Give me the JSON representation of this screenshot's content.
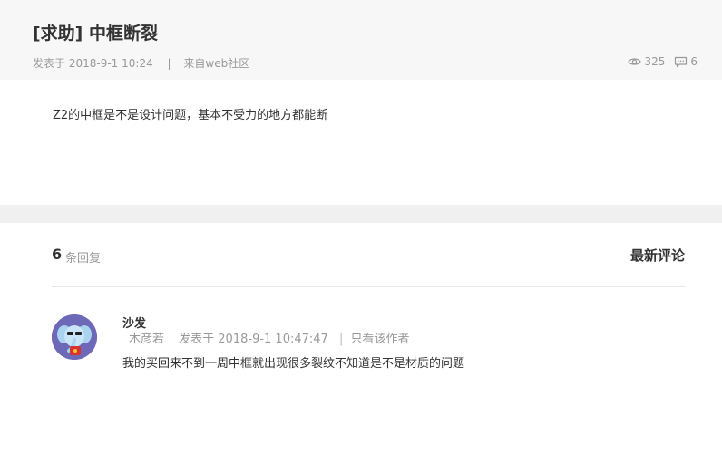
{
  "post": {
    "title": "[求助] 中框断裂",
    "posted_prefix": "发表于",
    "posted_time": "2018-9-1 10:24",
    "separator": "|",
    "source": "来自web社区",
    "views": "325",
    "comments": "6",
    "body": "Z2的中框是不是设计问题，基本不受力的地方都能断"
  },
  "replies": {
    "count": "6",
    "unit": "条回复",
    "sort_label": "最新评论",
    "items": [
      {
        "user": "沙发",
        "author": "木彦若",
        "posted": "发表于 2018-9-1 10:47:47",
        "pipe": "|",
        "only_author": "只看该作者",
        "text": "我的买回来不到一周中框就出现很多裂纹不知道是不是材质的问题"
      }
    ]
  },
  "icons": {
    "views": "eye-icon",
    "comments": "comment-icon",
    "avatar": "avatar-elephant"
  },
  "colors": {
    "header_bg": "#f7f7f7",
    "band_bg": "#f0f0f0",
    "text_main": "#333333",
    "text_muted": "#999999"
  }
}
